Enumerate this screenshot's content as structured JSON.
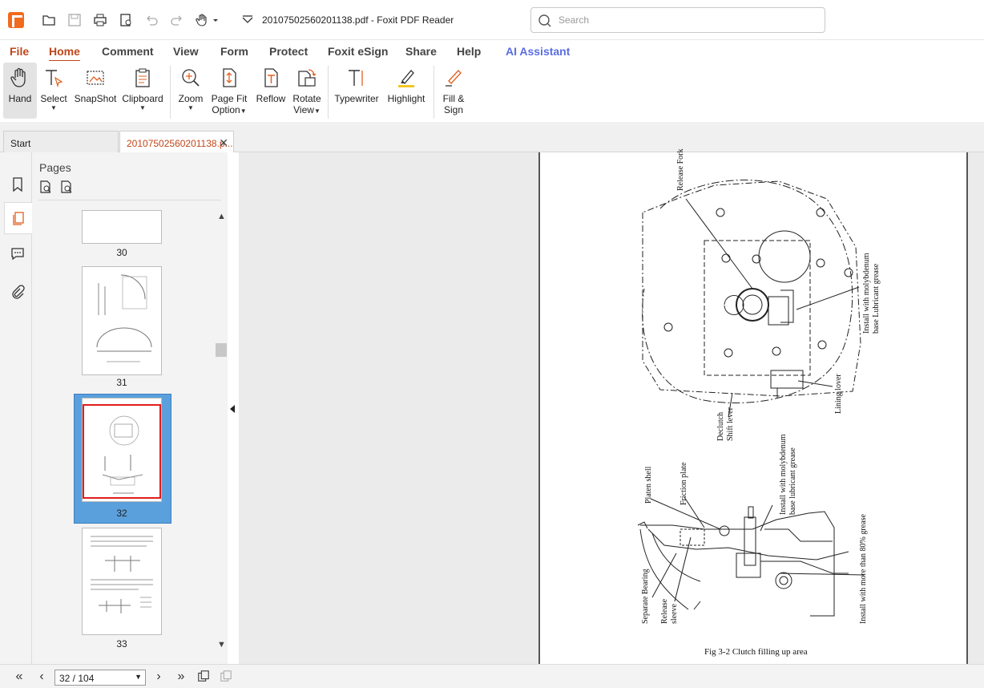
{
  "window": {
    "title": "20107502560201138.pdf - Foxit PDF Reader"
  },
  "search": {
    "placeholder": "Search"
  },
  "menu": [
    "File",
    "Home",
    "Comment",
    "View",
    "Form",
    "Protect",
    "Foxit eSign",
    "Share",
    "Help",
    "AI Assistant"
  ],
  "ribbon": {
    "hand": "Hand",
    "select": "Select",
    "snapshot": "SnapShot",
    "clipboard": "Clipboard",
    "zoom": "Zoom",
    "page_fit_1": "Page Fit",
    "page_fit_2": "Option",
    "reflow": "Reflow",
    "rotate_1": "Rotate",
    "rotate_2": "View",
    "typewriter": "Typewriter",
    "highlight": "Highlight",
    "fill_1": "Fill &",
    "fill_2": "Sign"
  },
  "tabs": {
    "start": "Start",
    "current": "20107502560201138.p..."
  },
  "panel": {
    "title": "Pages",
    "pages": [
      "30",
      "31",
      "32",
      "33"
    ],
    "selected_page": "32"
  },
  "document": {
    "caption": "Fig 3-2 Clutch filling up area",
    "labels": {
      "release_fork": "Release Fork",
      "install_top_1": "Install with molybdenum",
      "install_top_2": "base Lubricant grease",
      "lining_lover": "Lining lover",
      "declutch": "Declutch",
      "shift_lever": "Shift lever",
      "platen_shell": "Platen shell",
      "friction_plate": "Friction plate",
      "install_mid_1": "Install with molybdenum",
      "install_mid_2": "base lubricant grease",
      "install_80": "Install with more than 80% grease",
      "separate_bearing": "Separate Bearing",
      "release": "Release",
      "sleeve": "sleeve"
    }
  },
  "status": {
    "page_indicator": "32 / 104"
  },
  "colors": {
    "accent": "#c0461a",
    "ai": "#5b6ee0",
    "selection": "#5aa0dc",
    "thumb_border": "#e11d1d"
  }
}
